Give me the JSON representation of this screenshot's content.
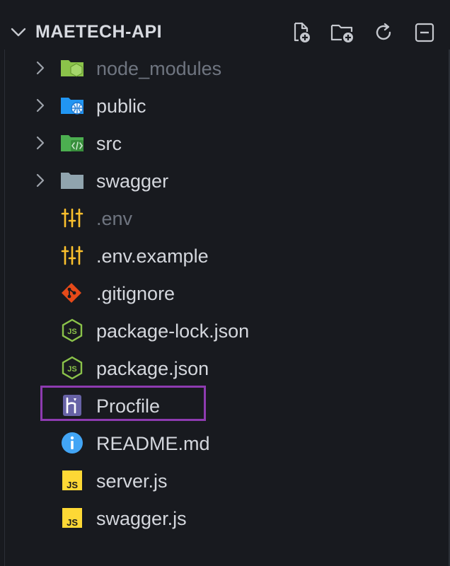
{
  "explorer": {
    "title": "MAETECH-API",
    "clipped_top_text": "",
    "actions": [
      {
        "name": "new-file",
        "icon": "new-file-icon"
      },
      {
        "name": "new-folder",
        "icon": "new-folder-icon"
      },
      {
        "name": "refresh",
        "icon": "refresh-icon"
      },
      {
        "name": "collapse-all",
        "icon": "collapse-all-icon"
      }
    ]
  },
  "tree": {
    "items": [
      {
        "label": "node_modules",
        "type": "folder",
        "icon": "node-folder-icon",
        "dim": true
      },
      {
        "label": "public",
        "type": "folder",
        "icon": "public-folder-icon"
      },
      {
        "label": "src",
        "type": "folder",
        "icon": "src-folder-icon"
      },
      {
        "label": "swagger",
        "type": "folder",
        "icon": "folder-icon"
      },
      {
        "label": ".env",
        "type": "file",
        "icon": "env-settings-icon",
        "dim": true
      },
      {
        "label": ".env.example",
        "type": "file",
        "icon": "env-settings-icon"
      },
      {
        "label": ".gitignore",
        "type": "file",
        "icon": "git-icon"
      },
      {
        "label": "package-lock.json",
        "type": "file",
        "icon": "nodejs-icon"
      },
      {
        "label": "package.json",
        "type": "file",
        "icon": "nodejs-icon"
      },
      {
        "label": "Procfile",
        "type": "file",
        "icon": "heroku-icon",
        "highlighted": true
      },
      {
        "label": "README.md",
        "type": "file",
        "icon": "info-icon"
      },
      {
        "label": "server.js",
        "type": "file",
        "icon": "js-icon"
      },
      {
        "label": "swagger.js",
        "type": "file",
        "icon": "js-icon"
      }
    ]
  },
  "colors": {
    "background": "#181a1f",
    "text": "#d4d7dd",
    "dim_text": "#6f7580",
    "highlight_border": "#8e3bb0"
  }
}
